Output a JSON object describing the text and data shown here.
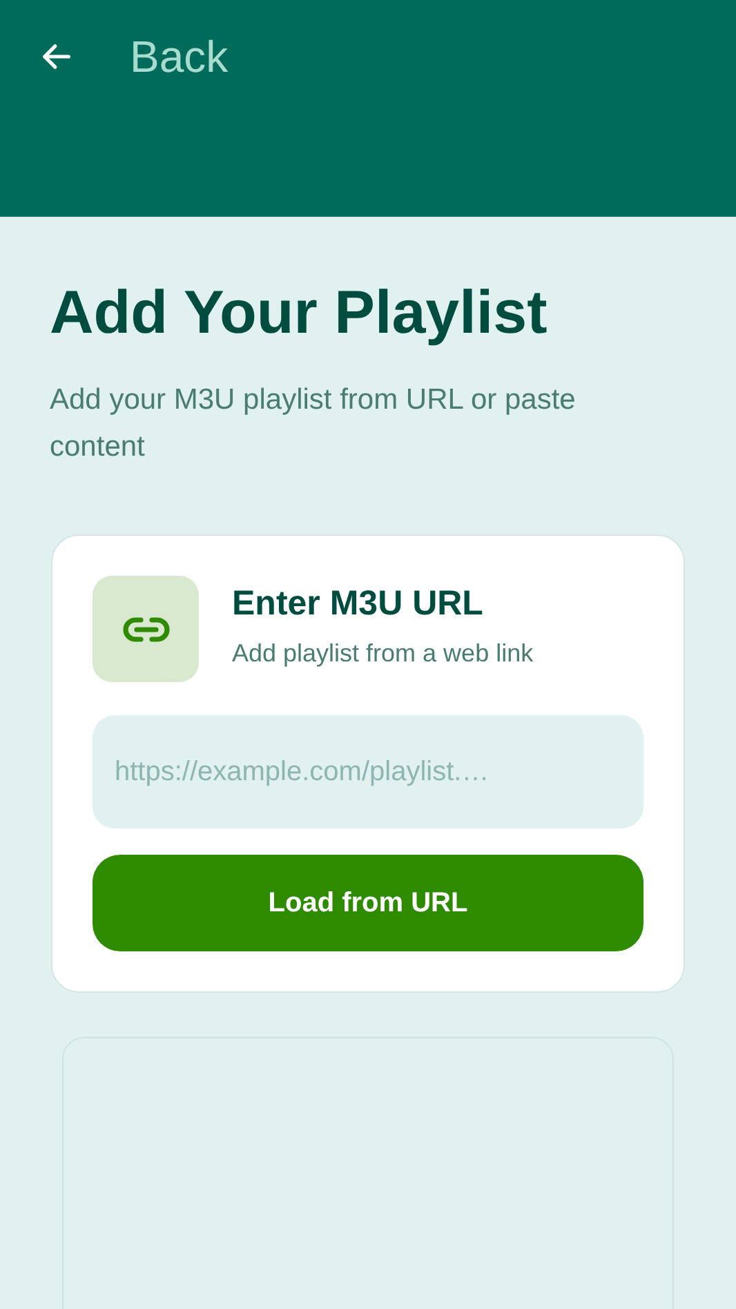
{
  "top_bar": {
    "back_label": "Back"
  },
  "title": "Add Your Playlist",
  "subtitle": "Add your M3U playlist from URL or paste content",
  "url_card": {
    "title": "Enter M3U URL",
    "subtitle": "Add playlist from a web link",
    "field": {
      "placeholder": "https://example.com/playlist.…"
    },
    "button": "Load from URL"
  }
}
